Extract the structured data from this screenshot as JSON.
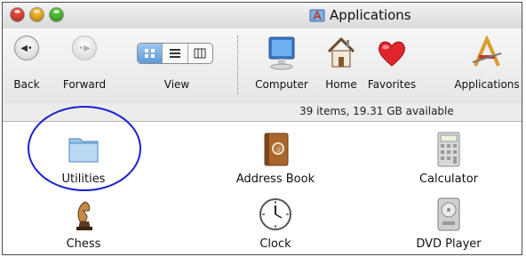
{
  "window": {
    "title": "Applications"
  },
  "toolbar": {
    "back_label": "Back",
    "forward_label": "Forward",
    "view_label": "View",
    "computer_label": "Computer",
    "home_label": "Home",
    "favorites_label": "Favorites",
    "applications_label": "Applications"
  },
  "status": {
    "text": "39 items, 19.31 GB available"
  },
  "items": [
    {
      "label": "Utilities",
      "icon": "folder-icon"
    },
    {
      "label": "Address Book",
      "icon": "address-book-icon"
    },
    {
      "label": "Calculator",
      "icon": "calculator-icon"
    },
    {
      "label": "Chess",
      "icon": "chess-icon"
    },
    {
      "label": "Clock",
      "icon": "clock-icon"
    },
    {
      "label": "DVD Player",
      "icon": "dvd-player-icon"
    }
  ],
  "colors": {
    "highlight_circle": "#1a1fd0",
    "view_active": "#5e9ad8"
  }
}
